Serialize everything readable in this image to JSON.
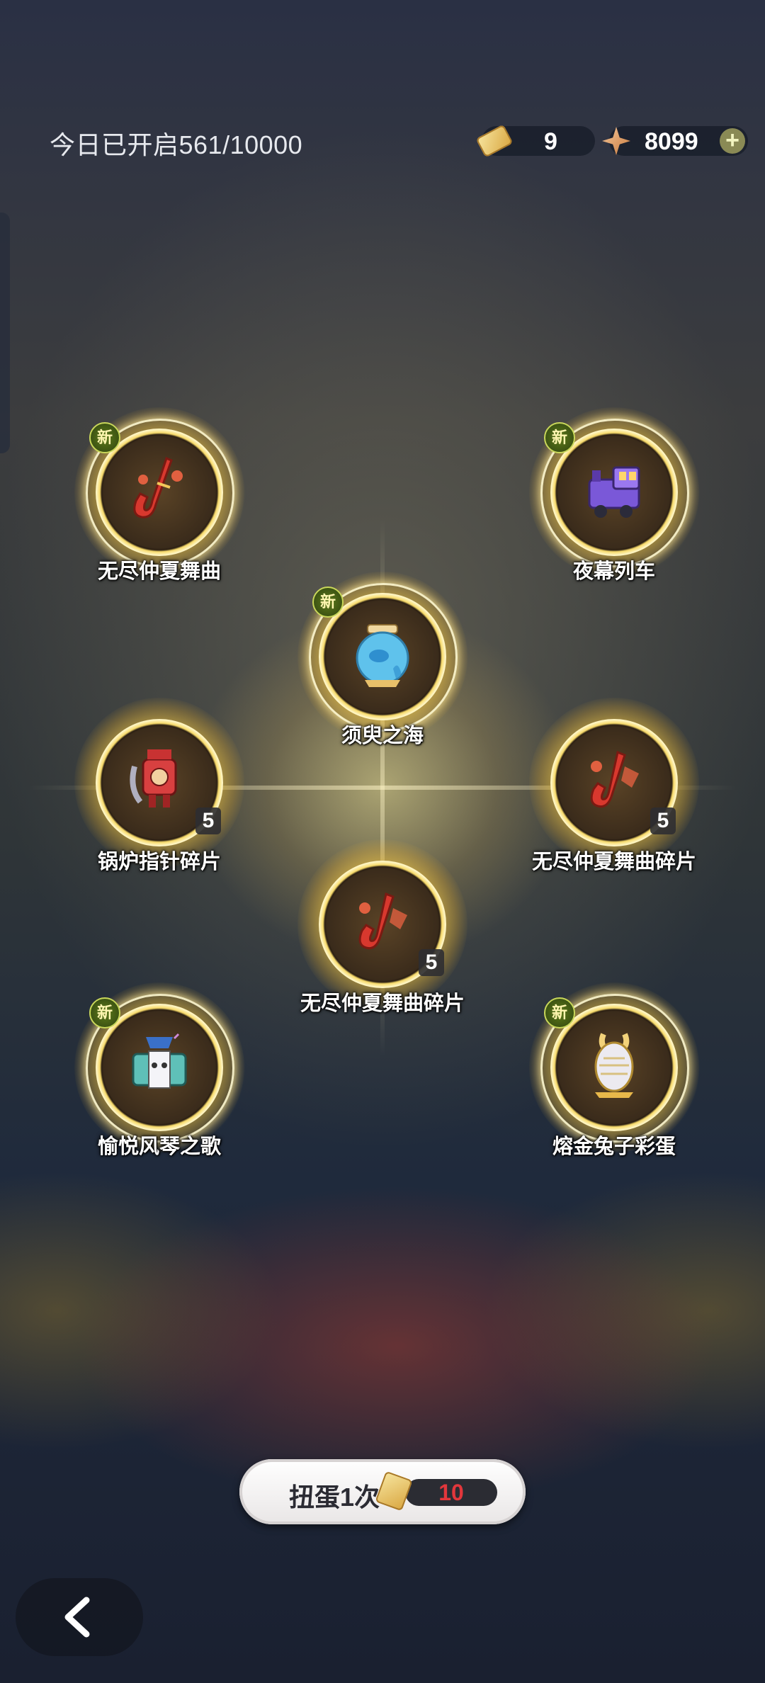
{
  "header": {
    "opened_today": "今日已开启561/10000",
    "tickets": {
      "icon": "ticket-icon",
      "value": "9"
    },
    "stars": {
      "icon": "star-currency-icon",
      "value": "8099",
      "add_icon": "plus-icon"
    }
  },
  "items": [
    {
      "label": "无尽仲夏舞曲",
      "new_badge": "新",
      "count": "",
      "icon": "saxophone-icon",
      "color": "#d8382e"
    },
    {
      "label": "夜幕列车",
      "new_badge": "新",
      "count": "",
      "icon": "train-icon",
      "color": "#7a58d8"
    },
    {
      "label": "须臾之海",
      "new_badge": "新",
      "count": "",
      "icon": "fishbowl-icon",
      "color": "#5fc2ec"
    },
    {
      "label": "锅炉指针碎片",
      "new_badge": "",
      "count": "5",
      "icon": "robot-fragment-icon",
      "color": "#d84040"
    },
    {
      "label": "无尽仲夏舞曲碎片",
      "new_badge": "",
      "count": "5",
      "icon": "saxophone-fragment-icon",
      "color": "#d8382e"
    },
    {
      "label": "无尽仲夏舞曲碎片",
      "new_badge": "",
      "count": "5",
      "icon": "saxophone-fragment-icon",
      "color": "#d8382e"
    },
    {
      "label": "愉悦风琴之歌",
      "new_badge": "新",
      "count": "",
      "icon": "accordion-icon",
      "color": "#5fc0b8"
    },
    {
      "label": "熔金兔子彩蛋",
      "new_badge": "新",
      "count": "",
      "icon": "golden-egg-icon",
      "color": "#e8d9a8"
    }
  ],
  "gacha_button": {
    "label": "扭蛋1次",
    "cost": "10",
    "icon": "ticket-icon"
  },
  "back_button": {
    "icon": "chevron-left-icon"
  }
}
